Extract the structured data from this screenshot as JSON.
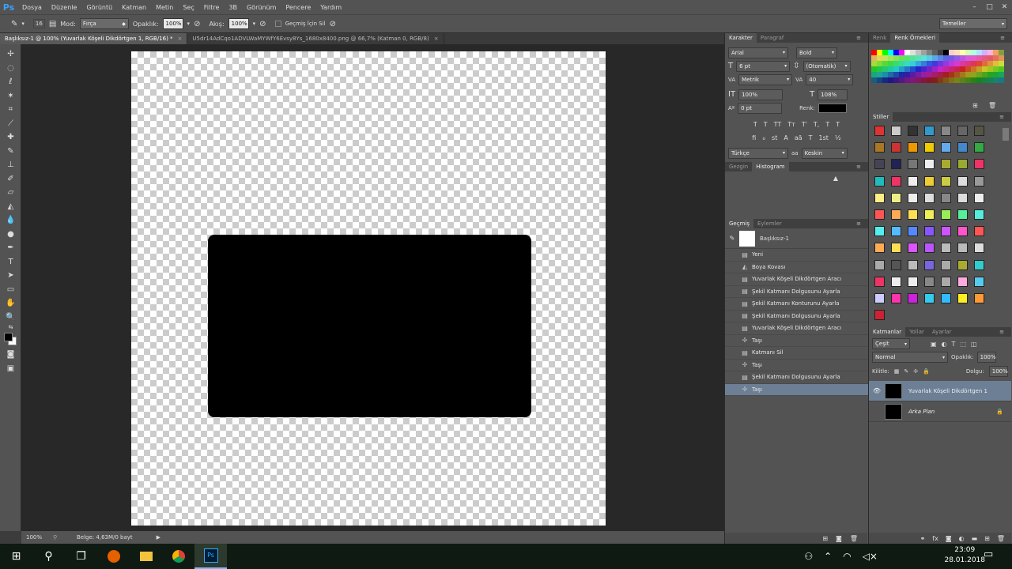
{
  "app": {
    "logo": "Ps"
  },
  "menu": [
    "Dosya",
    "Düzenle",
    "Görüntü",
    "Katman",
    "Metin",
    "Seç",
    "Filtre",
    "3B",
    "Görünüm",
    "Pencere",
    "Yardım"
  ],
  "window_controls": [
    "–",
    "□",
    "✕"
  ],
  "options": {
    "brush_size": "16",
    "mode_label": "Mod:",
    "mode_value": "Fırça",
    "opacity_label": "Opaklık:",
    "opacity_value": "100%",
    "flow_label": "Akış:",
    "flow_value": "100%",
    "history_checkbox_label": "Geçmiş İçin Sil",
    "workspace": "Temeller"
  },
  "tabs": [
    {
      "label": "Başlıksız-1 @ 100% (Yuvarlak Köşeli Dikdörtgen 1, RGB/16) *",
      "close": "×"
    },
    {
      "label": "U5dr14AdCqo1ADVLWaMYWfY6Evsy8Ys_1680x8400.png @ 66,7% (Katman 0, RGB/8)",
      "close": "×"
    }
  ],
  "status": {
    "zoom": "100%",
    "doc": "Belge: 4,63M/0 bayt"
  },
  "character": {
    "tabs": [
      "Karakter",
      "Paragraf"
    ],
    "font": "Arial",
    "style": "Bold",
    "size": "6 pt",
    "leading": "(Otomatik)",
    "kerning": "Metrik",
    "tracking": "40",
    "vscale": "100%",
    "hscale": "108%",
    "baseline": "0 pt",
    "color_label": "Renk:",
    "color": "#000000",
    "lang": "Türkçe",
    "aa": "Keskin",
    "type_buttons1": [
      "T",
      "T",
      "TT",
      "Tт",
      "T'",
      "T,",
      "T",
      "T"
    ],
    "type_buttons2": [
      "fi",
      "ℴ",
      "st",
      "A",
      "aā",
      "T",
      "1st",
      "½"
    ]
  },
  "nav": {
    "tabs": [
      "Gezgin",
      "Histogram"
    ],
    "warning": "▲"
  },
  "history": {
    "tabs": [
      "Geçmiş",
      "Eylemler"
    ],
    "snapshot": "Başlıksız-1",
    "items": [
      "Yeni",
      "Boya Kovası",
      "Yuvarlak Köşeli Dikdörtgen Aracı",
      "Şekil Katmanı Dolgusunu Ayarla",
      "Şekil Katmanı Konturunu Ayarla",
      "Şekil Katmanı Dolgusunu Ayarla",
      "Yuvarlak Köşeli Dikdörtgen Aracı",
      "Taşı",
      "Katmanı Sil",
      "Taşı",
      "Şekil Katmanı Dolgusunu Ayarla",
      "Taşı"
    ]
  },
  "swatches_panel": {
    "tabs": [
      "Renk",
      "Renk Örnekleri"
    ]
  },
  "styles_panel": {
    "title": "Stiller"
  },
  "layers": {
    "tabs": [
      "Katmanlar",
      "Yollar",
      "Ayarlar"
    ],
    "filter": "Çeşit",
    "blend": "Normal",
    "opacity_label": "Opaklık:",
    "opacity": "100%",
    "lock_label": "Kilitle:",
    "fill_label": "Dolgu:",
    "fill": "100%",
    "items": [
      {
        "name": "Yuvarlak Köşeli Dikdörtgen 1"
      },
      {
        "name": "Arka Plan"
      }
    ]
  },
  "taskbar": {
    "time": "23:09",
    "date": "28.01.2018"
  }
}
